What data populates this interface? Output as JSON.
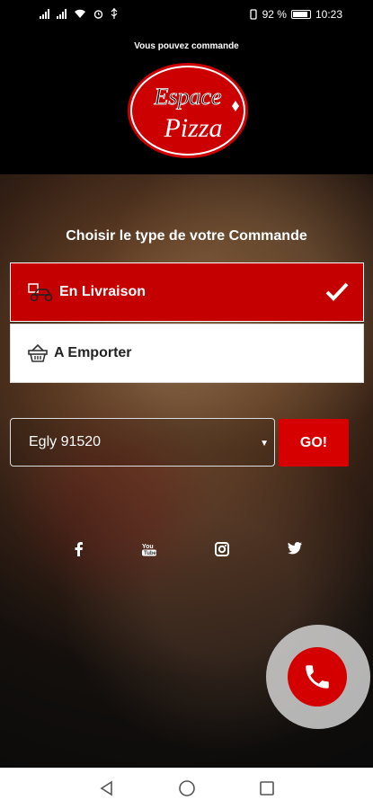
{
  "status_bar": {
    "battery_percent": "92 %",
    "time": "10:23"
  },
  "header": {
    "ticker_text": "Vous pouvez commande",
    "logo_line1": "Espace",
    "logo_line2": "Pizza"
  },
  "order": {
    "title": "Choisir le type de votre Commande",
    "options": [
      {
        "label": "En Livraison",
        "selected": true,
        "icon": "delivery-scooter-icon"
      },
      {
        "label": "A Emporter",
        "selected": false,
        "icon": "basket-icon"
      }
    ]
  },
  "city": {
    "selected_value": "Egly 91520",
    "go_label": "GO!"
  },
  "socials": [
    {
      "name": "facebook",
      "glyph": "f"
    },
    {
      "name": "youtube",
      "glyph": "You"
    },
    {
      "name": "instagram",
      "glyph": "◘"
    },
    {
      "name": "twitter",
      "glyph": "🐦"
    }
  ],
  "colors": {
    "accent": "#d60000",
    "background": "#000000"
  }
}
